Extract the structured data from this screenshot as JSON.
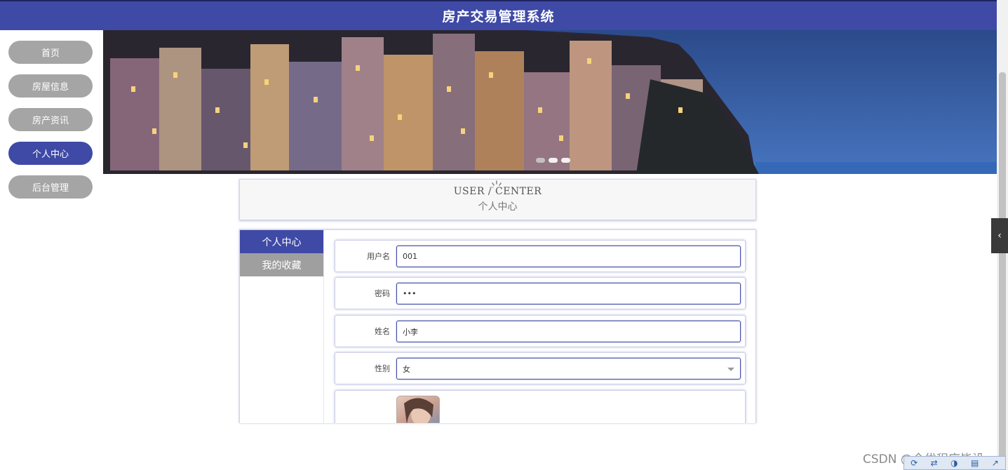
{
  "header": {
    "title": "房产交易管理系统"
  },
  "nav": {
    "items": [
      {
        "label": "首页"
      },
      {
        "label": "房屋信息"
      },
      {
        "label": "房产资讯"
      },
      {
        "label": "个人中心"
      },
      {
        "label": "后台管理"
      }
    ],
    "active": "个人中心"
  },
  "banner": {
    "slides": 3,
    "current_slide": 1
  },
  "section_title": {
    "english": "USER / CENTER",
    "chinese": "个人中心"
  },
  "sidebar": {
    "tabs": [
      {
        "label": "个人中心"
      },
      {
        "label": "我的收藏"
      }
    ]
  },
  "form": {
    "username": {
      "label": "用户名",
      "value": "001"
    },
    "password": {
      "label": "密码",
      "value": "•••"
    },
    "name": {
      "label": "姓名",
      "value": "小李"
    },
    "gender": {
      "label": "性别",
      "value": "女"
    }
  },
  "edge_tab": {
    "icon": "chevron-left-icon",
    "glyph": "‹"
  },
  "watermark": "CSDN @全优程序毕设",
  "colors": {
    "primary": "#3f4aa6",
    "inactive": "#a5a5a5"
  }
}
